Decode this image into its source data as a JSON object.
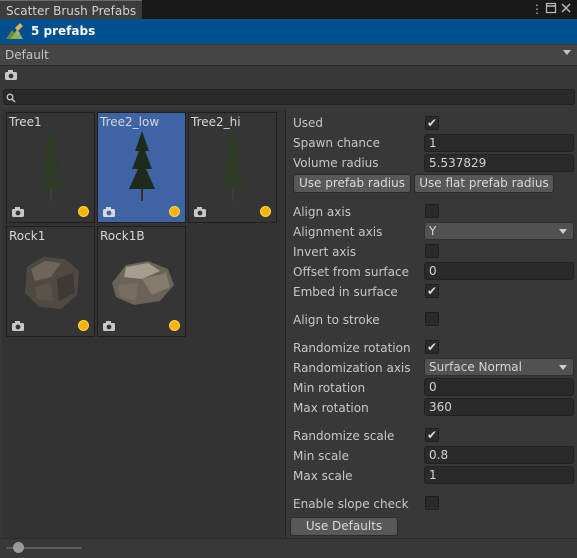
{
  "window": {
    "tab_title": "Scatter Brush Prefabs",
    "icons": [
      "more-icon",
      "maximize-icon",
      "close-icon"
    ]
  },
  "header": {
    "title": "5 prefabs",
    "icon": "brush-icon"
  },
  "preset": {
    "value": "Default"
  },
  "search": {
    "placeholder": "",
    "value": ""
  },
  "prefabs": [
    {
      "name": "Tree1",
      "kind": "tree",
      "selected": false
    },
    {
      "name": "Tree2_low",
      "kind": "tree",
      "selected": true
    },
    {
      "name": "Tree2_hi",
      "kind": "tree",
      "selected": false
    },
    {
      "name": "Rock1",
      "kind": "rock",
      "selected": false
    },
    {
      "name": "Rock1B",
      "kind": "rock",
      "selected": false
    }
  ],
  "settings": {
    "used": {
      "label": "Used",
      "checked": true
    },
    "spawn_chance": {
      "label": "Spawn chance",
      "value": "1"
    },
    "volume_radius": {
      "label": "Volume radius",
      "value": "5.537829"
    },
    "use_prefab_radius": "Use prefab radius",
    "use_flat_prefab_radius": "Use flat prefab radius",
    "align_axis": {
      "label": "Align axis",
      "checked": false
    },
    "alignment_axis": {
      "label": "Alignment axis",
      "value": "Y"
    },
    "invert_axis": {
      "label": "Invert axis",
      "checked": false
    },
    "offset_from_surface": {
      "label": "Offset from surface",
      "value": "0"
    },
    "embed_in_surface": {
      "label": "Embed in surface",
      "checked": true
    },
    "align_to_stroke": {
      "label": "Align to stroke",
      "checked": false
    },
    "randomize_rotation": {
      "label": "Randomize rotation",
      "checked": true
    },
    "randomization_axis": {
      "label": "Randomization axis",
      "value": "Surface Normal"
    },
    "min_rotation": {
      "label": "Min rotation",
      "value": "0"
    },
    "max_rotation": {
      "label": "Max rotation",
      "value": "360"
    },
    "randomize_scale": {
      "label": "Randomize scale",
      "checked": true
    },
    "min_scale": {
      "label": "Min scale",
      "value": "0.8"
    },
    "max_scale": {
      "label": "Max scale",
      "value": "1"
    },
    "enable_slope_check": {
      "label": "Enable slope check",
      "checked": false
    },
    "use_defaults": "Use Defaults"
  },
  "thumbnail_size": {
    "value": 0.1
  },
  "colors": {
    "header": "#004f8e",
    "selected": "#3f64a6",
    "status_dot": "#f8b400"
  }
}
